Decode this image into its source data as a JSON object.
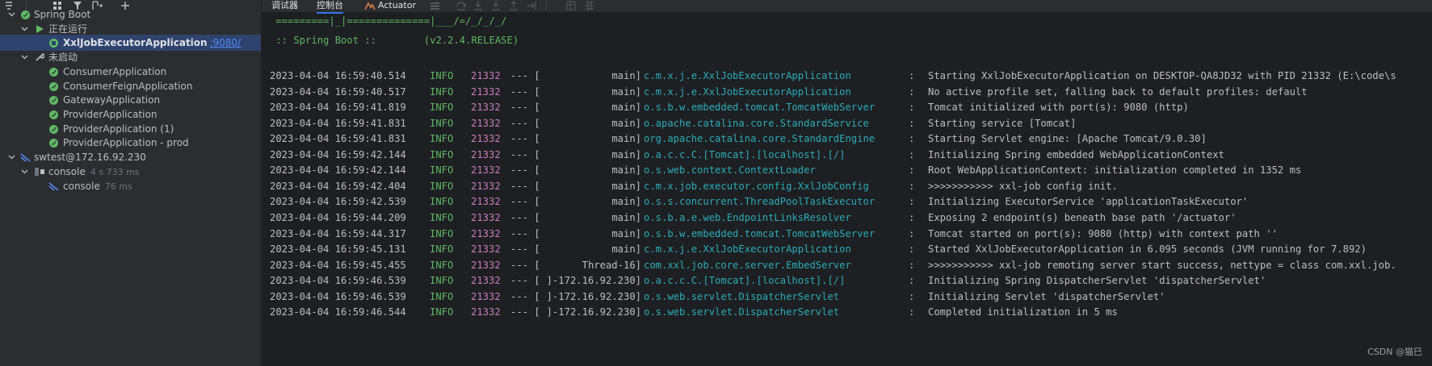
{
  "services_tree": {
    "items": [
      {
        "label": "Spring Boot"
      },
      {
        "label": "正在运行"
      },
      {
        "label": "XxlJobExecutorApplication",
        "port": ":9080/"
      },
      {
        "label": "未启动"
      },
      {
        "label": "ConsumerApplication"
      },
      {
        "label": "ConsumerFeignApplication"
      },
      {
        "label": "GatewayApplication"
      },
      {
        "label": "ProviderApplication"
      },
      {
        "label": "ProviderApplication (1)"
      },
      {
        "label": "ProviderApplication - prod"
      },
      {
        "label": "swtest@172.16.92.230"
      },
      {
        "label": "console",
        "meta": "4 s 733 ms"
      },
      {
        "label": "console",
        "meta": "76 ms"
      }
    ]
  },
  "tabs": {
    "debugger": "调试器",
    "console": "控制台",
    "actuator": "Actuator"
  },
  "console": {
    "banner_line1": " =========|_|==============|___/=/_/_/_/",
    "banner_line2": " :: Spring Boot ::        (v2.2.4.RELEASE)",
    "lines": [
      {
        "ts": "2023-04-04 16:59:40.514",
        "level": "INFO",
        "pid": "21332",
        "sep": "--- [",
        "thread": "main]",
        "logger": "c.m.x.j.e.XxlJobExecutorApplication",
        "colon": ":",
        "msg": "Starting XxlJobExecutorApplication on DESKTOP-QA8JD32 with PID 21332 (E:\\code\\s"
      },
      {
        "ts": "2023-04-04 16:59:40.517",
        "level": "INFO",
        "pid": "21332",
        "sep": "--- [",
        "thread": "main]",
        "logger": "c.m.x.j.e.XxlJobExecutorApplication",
        "colon": ":",
        "msg": "No active profile set, falling back to default profiles: default"
      },
      {
        "ts": "2023-04-04 16:59:41.819",
        "level": "INFO",
        "pid": "21332",
        "sep": "--- [",
        "thread": "main]",
        "logger": "o.s.b.w.embedded.tomcat.TomcatWebServer",
        "colon": ":",
        "msg": "Tomcat initialized with port(s): 9080 (http)"
      },
      {
        "ts": "2023-04-04 16:59:41.831",
        "level": "INFO",
        "pid": "21332",
        "sep": "--- [",
        "thread": "main]",
        "logger": "o.apache.catalina.core.StandardService",
        "colon": ":",
        "msg": "Starting service [Tomcat]"
      },
      {
        "ts": "2023-04-04 16:59:41.831",
        "level": "INFO",
        "pid": "21332",
        "sep": "--- [",
        "thread": "main]",
        "logger": "org.apache.catalina.core.StandardEngine",
        "colon": ":",
        "msg": "Starting Servlet engine: [Apache Tomcat/9.0.30]"
      },
      {
        "ts": "2023-04-04 16:59:42.144",
        "level": "INFO",
        "pid": "21332",
        "sep": "--- [",
        "thread": "main]",
        "logger": "o.a.c.c.C.[Tomcat].[localhost].[/]",
        "colon": ":",
        "msg": "Initializing Spring embedded WebApplicationContext"
      },
      {
        "ts": "2023-04-04 16:59:42.144",
        "level": "INFO",
        "pid": "21332",
        "sep": "--- [",
        "thread": "main]",
        "logger": "o.s.web.context.ContextLoader",
        "colon": ":",
        "msg": "Root WebApplicationContext: initialization completed in 1352 ms"
      },
      {
        "ts": "2023-04-04 16:59:42.404",
        "level": "INFO",
        "pid": "21332",
        "sep": "--- [",
        "thread": "main]",
        "logger": "c.m.x.job.executor.config.XxlJobConfig",
        "colon": ":",
        "msg": ">>>>>>>>>>> xxl-job config init."
      },
      {
        "ts": "2023-04-04 16:59:42.539",
        "level": "INFO",
        "pid": "21332",
        "sep": "--- [",
        "thread": "main]",
        "logger": "o.s.s.concurrent.ThreadPoolTaskExecutor",
        "colon": ":",
        "msg": "Initializing ExecutorService 'applicationTaskExecutor'"
      },
      {
        "ts": "2023-04-04 16:59:44.209",
        "level": "INFO",
        "pid": "21332",
        "sep": "--- [",
        "thread": "main]",
        "logger": "o.s.b.a.e.web.EndpointLinksResolver",
        "colon": ":",
        "msg": "Exposing 2 endpoint(s) beneath base path '/actuator'"
      },
      {
        "ts": "2023-04-04 16:59:44.317",
        "level": "INFO",
        "pid": "21332",
        "sep": "--- [",
        "thread": "main]",
        "logger": "o.s.b.w.embedded.tomcat.TomcatWebServer",
        "colon": ":",
        "msg": "Tomcat started on port(s): 9080 (http) with context path ''"
      },
      {
        "ts": "2023-04-04 16:59:45.131",
        "level": "INFO",
        "pid": "21332",
        "sep": "--- [",
        "thread": "main]",
        "logger": "c.m.x.j.e.XxlJobExecutorApplication",
        "colon": ":",
        "msg": "Started XxlJobExecutorApplication in 6.095 seconds (JVM running for 7.892)"
      },
      {
        "ts": "2023-04-04 16:59:45.455",
        "level": "INFO",
        "pid": "21332",
        "sep": "--- [",
        "thread": "Thread-16]",
        "logger": "com.xxl.job.core.server.EmbedServer",
        "colon": ":",
        "msg": ">>>>>>>>>>> xxl-job remoting server start success, nettype = class com.xxl.job."
      },
      {
        "ts": "2023-04-04 16:59:46.539",
        "level": "INFO",
        "pid": "21332",
        "sep": "--- [",
        "thread": "]-172.16.92.230]",
        "logger": "o.a.c.c.C.[Tomcat].[localhost].[/]",
        "colon": ":",
        "msg": "Initializing Spring DispatcherServlet 'dispatcherServlet'"
      },
      {
        "ts": "2023-04-04 16:59:46.539",
        "level": "INFO",
        "pid": "21332",
        "sep": "--- [",
        "thread": "]-172.16.92.230]",
        "logger": "o.s.web.servlet.DispatcherServlet",
        "colon": ":",
        "msg": "Initializing Servlet 'dispatcherServlet'"
      },
      {
        "ts": "2023-04-04 16:59:46.544",
        "level": "INFO",
        "pid": "21332",
        "sep": "--- [",
        "thread": "]-172.16.92.230]",
        "logger": "o.s.web.servlet.DispatcherServlet",
        "colon": ":",
        "msg": "Completed initialization in 5 ms"
      }
    ]
  },
  "watermark": "CSDN @猫巳",
  "colors": {
    "accent": "#3574f0",
    "selection": "#2e436e",
    "info": "#5fb865",
    "pid": "#c77dbb",
    "logger": "#2aacb8"
  },
  "icons": {
    "toolbar": [
      "collapse-all-icon",
      "group-icon",
      "filter-icon",
      "new-tab-icon",
      "add-icon"
    ],
    "tabs_toolbar": [
      "menu-icon",
      "step-over-icon",
      "step-into-icon",
      "force-step-icon",
      "step-out-icon",
      "run-to-cursor-icon",
      "frames-icon",
      "threads-icon"
    ]
  }
}
